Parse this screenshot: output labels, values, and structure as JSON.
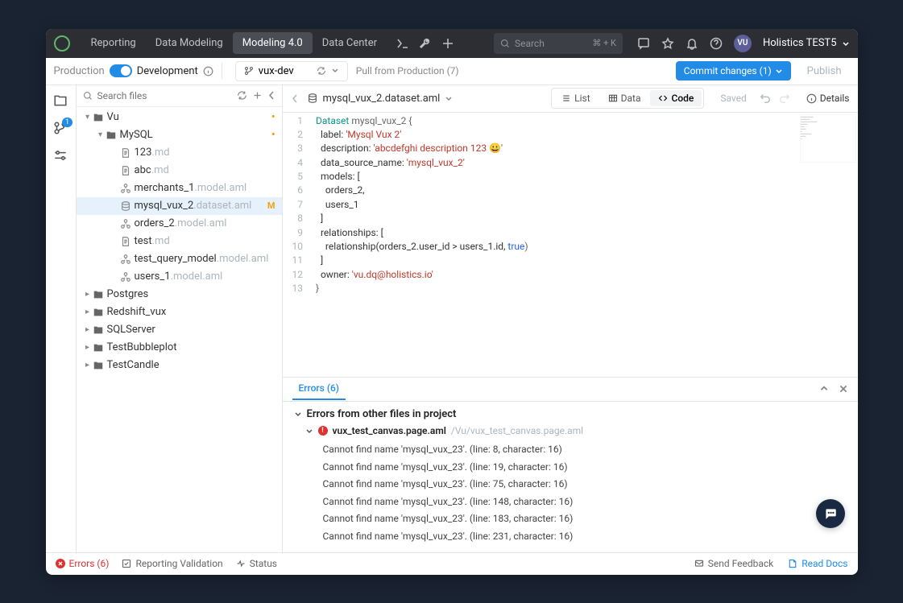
{
  "topnav": {
    "items": [
      "Reporting",
      "Data Modeling",
      "Modeling 4.0",
      "Data Center"
    ],
    "activeIndex": 2
  },
  "search": {
    "placeholder": "Search",
    "shortcut": "⌘ + K"
  },
  "user": {
    "initials": "VU",
    "tenant": "Holistics TEST5"
  },
  "subbar": {
    "production": "Production",
    "development": "Development",
    "branch": "vux-dev",
    "pull": "Pull from Production (7)",
    "commit": "Commit changes (1)",
    "publish": "Publish"
  },
  "rail": {
    "badge": "1"
  },
  "sidebar": {
    "searchPlaceholder": "Search files",
    "tree": [
      {
        "type": "folder",
        "indent": 0,
        "name": "Vu",
        "expanded": true,
        "modified": true
      },
      {
        "type": "folder",
        "indent": 1,
        "name": "MySQL",
        "expanded": true,
        "modified": true
      },
      {
        "type": "file",
        "indent": 2,
        "name": "123",
        "ext": ".md",
        "icon": "doc"
      },
      {
        "type": "file",
        "indent": 2,
        "name": "abc",
        "ext": ".md",
        "icon": "doc"
      },
      {
        "type": "file",
        "indent": 2,
        "name": "merchants_1",
        "ext": ".model.aml",
        "icon": "model"
      },
      {
        "type": "file",
        "indent": 2,
        "name": "mysql_vux_2",
        "ext": ".dataset.aml",
        "icon": "dataset",
        "active": true,
        "modLetter": "M"
      },
      {
        "type": "file",
        "indent": 2,
        "name": "orders_2",
        "ext": ".model.aml",
        "icon": "model"
      },
      {
        "type": "file",
        "indent": 2,
        "name": "test",
        "ext": ".md",
        "icon": "doc"
      },
      {
        "type": "file",
        "indent": 2,
        "name": "test_query_model",
        "ext": ".model.aml",
        "icon": "model"
      },
      {
        "type": "file",
        "indent": 2,
        "name": "users_1",
        "ext": ".model.aml",
        "icon": "model"
      },
      {
        "type": "folder",
        "indent": 0,
        "name": "Postgres",
        "expanded": false
      },
      {
        "type": "folder",
        "indent": 0,
        "name": "Redshift_vux",
        "expanded": false
      },
      {
        "type": "folder",
        "indent": 0,
        "name": "SQLServer",
        "expanded": false
      },
      {
        "type": "folder",
        "indent": 0,
        "name": "TestBubbleplot",
        "expanded": false
      },
      {
        "type": "folder",
        "indent": 0,
        "name": "TestCandle",
        "expanded": false
      }
    ]
  },
  "editor": {
    "filename": "mysql_vux_2.dataset.aml",
    "viewTabs": [
      "List",
      "Data",
      "Code"
    ],
    "activeTab": 2,
    "savedLabel": "Saved",
    "detailsLabel": "Details",
    "lines": [
      [
        {
          "c": "kw",
          "t": "Dataset"
        },
        {
          "c": "p",
          "t": " mysql_vux_2 {"
        }
      ],
      [
        {
          "c": "i",
          "t": "  label: "
        },
        {
          "c": "str",
          "t": "'Mysql Vux 2'"
        }
      ],
      [
        {
          "c": "i",
          "t": "  description: "
        },
        {
          "c": "str",
          "t": "'abcdefghi description 123 😀'"
        }
      ],
      [
        {
          "c": "i",
          "t": "  data_source_name: "
        },
        {
          "c": "str",
          "t": "'mysql_vux_2'"
        }
      ],
      [
        {
          "c": "i",
          "t": "  models: ["
        }
      ],
      [
        {
          "c": "i",
          "t": "    orders_2,"
        }
      ],
      [
        {
          "c": "i",
          "t": "    users_1"
        }
      ],
      [
        {
          "c": "i",
          "t": "  ]"
        }
      ],
      [
        {
          "c": "i",
          "t": "  relationships: ["
        }
      ],
      [
        {
          "c": "i",
          "t": "    relationship(orders_2.user_id > users_1.id, "
        },
        {
          "c": "bool",
          "t": "true"
        },
        {
          "c": "p",
          "t": ")"
        }
      ],
      [
        {
          "c": "i",
          "t": "  ]"
        }
      ],
      [
        {
          "c": "i",
          "t": "  owner: "
        },
        {
          "c": "str",
          "t": "'vu.dq@holistics.io'"
        }
      ],
      [
        {
          "c": "p",
          "t": "}"
        }
      ]
    ]
  },
  "errors": {
    "tabLabel": "Errors (6)",
    "groupTitle": "Errors from other files in project",
    "file": {
      "name": "vux_test_canvas.page.aml",
      "path": "/Vu/vux_test_canvas.page.aml"
    },
    "items": [
      "Cannot find name 'mysql_vux_23'. (line: 8, character: 16)",
      "Cannot find name 'mysql_vux_23'. (line: 19, character: 16)",
      "Cannot find name 'mysql_vux_23'. (line: 75, character: 16)",
      "Cannot find name 'mysql_vux_23'. (line: 148, character: 16)",
      "Cannot find name 'mysql_vux_23'. (line: 183, character: 16)",
      "Cannot find name 'mysql_vux_23'. (line: 231, character: 16)"
    ]
  },
  "statusbar": {
    "errors": "Errors (6)",
    "reporting": "Reporting Validation",
    "status": "Status",
    "feedback": "Send Feedback",
    "docs": "Read Docs"
  }
}
